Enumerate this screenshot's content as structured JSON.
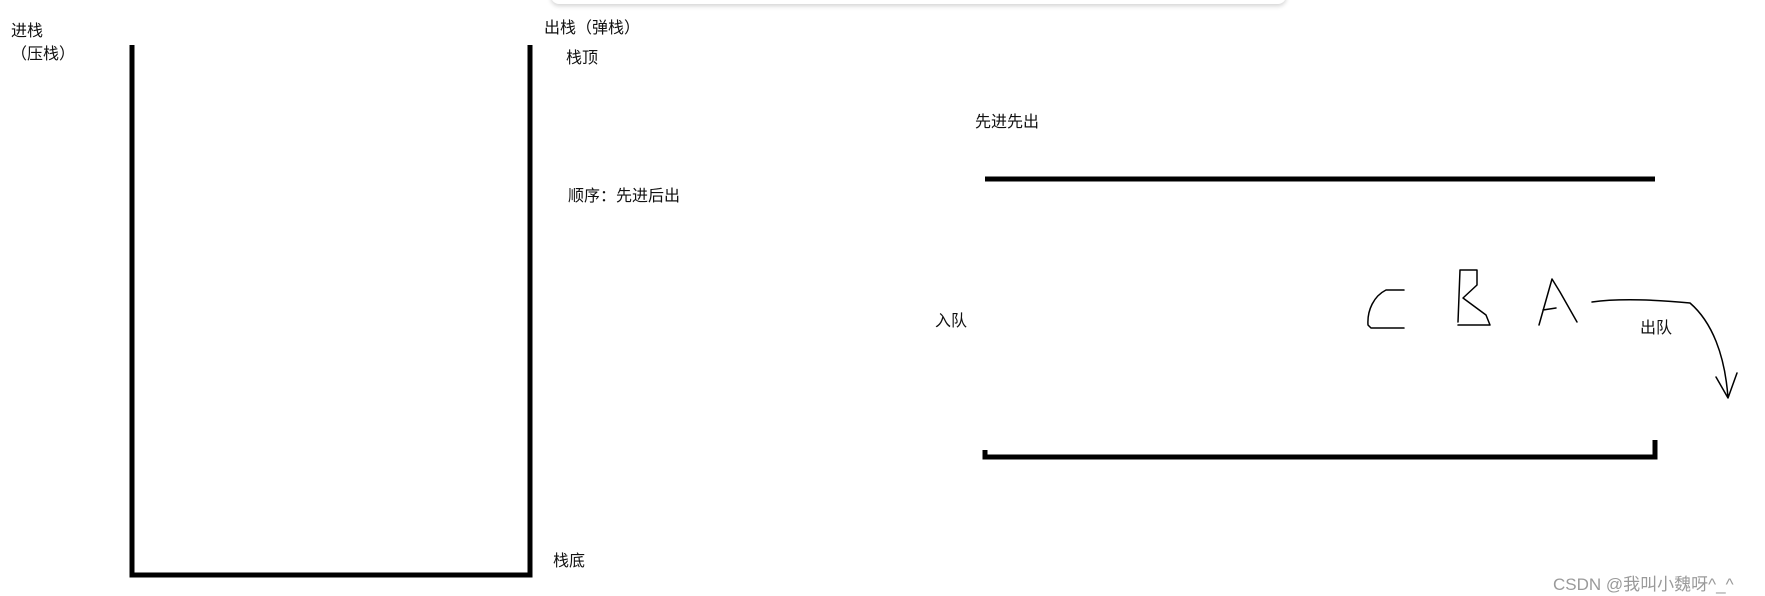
{
  "stack": {
    "push_label_1": "进栈",
    "push_label_2": "（压栈）",
    "pop_label": "出栈（弹栈）",
    "top_label": "栈顶",
    "order_label": "顺序：先进后出",
    "bottom_label": "栈底"
  },
  "queue": {
    "order_label": "先进先出",
    "enqueue_label": "入队",
    "dequeue_label": "出队",
    "elements": [
      "C",
      "B",
      "A"
    ]
  },
  "watermark": "CSDN @我叫小魏呀^_^",
  "colors": {
    "stroke": "#000000",
    "watermark": "#9a9a9a"
  }
}
